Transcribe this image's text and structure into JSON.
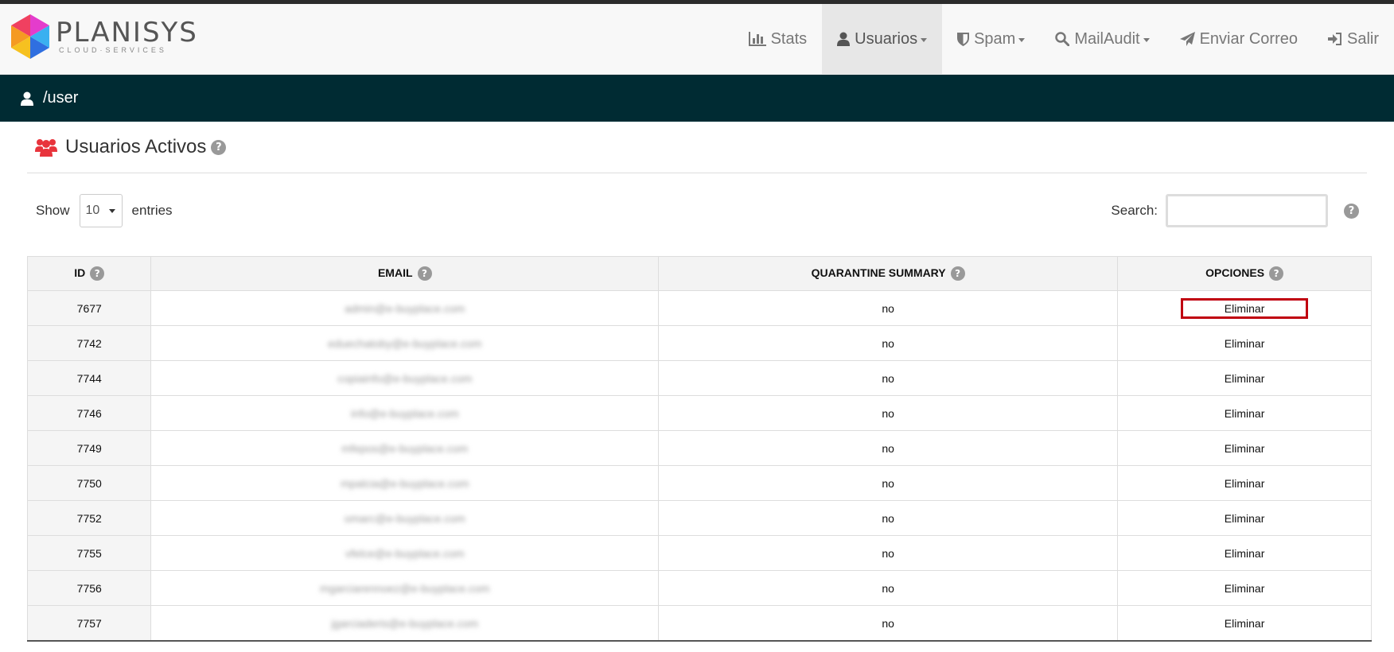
{
  "brand": {
    "name": "PLANISYS",
    "subtitle": "CLOUD·SERVICES"
  },
  "nav": [
    {
      "label": "Stats",
      "icon": "bar-chart-icon",
      "caret": false,
      "active": false
    },
    {
      "label": "Usuarios",
      "icon": "user-icon",
      "caret": true,
      "active": true
    },
    {
      "label": "Spam",
      "icon": "shield-icon",
      "caret": true,
      "active": false
    },
    {
      "label": "MailAudit",
      "icon": "search-icon",
      "caret": true,
      "active": false
    },
    {
      "label": "Enviar Correo",
      "icon": "paper-plane-icon",
      "caret": false,
      "active": false
    },
    {
      "label": "Salir",
      "icon": "sign-in-icon",
      "caret": false,
      "active": false
    }
  ],
  "path": "/user",
  "page": {
    "title": "Usuarios Activos"
  },
  "controls": {
    "show_label": "Show",
    "entries_value": "10",
    "entries_label": "entries",
    "search_label": "Search:",
    "search_value": ""
  },
  "table": {
    "headers": [
      "ID",
      "EMAIL",
      "QUARANTINE SUMMARY",
      "OPCIONES"
    ],
    "rows": [
      {
        "id": "7677",
        "email": "admin@e-buyplace.com",
        "summary": "no",
        "action": "Eliminar",
        "highlight": true
      },
      {
        "id": "7742",
        "email": "eduechatoby@e-buyplace.com",
        "summary": "no",
        "action": "Eliminar",
        "highlight": false
      },
      {
        "id": "7744",
        "email": "copiainfo@e-buyplace.com",
        "summary": "no",
        "action": "Eliminar",
        "highlight": false
      },
      {
        "id": "7746",
        "email": "info@e-buyplace.com",
        "summary": "no",
        "action": "Eliminar",
        "highlight": false
      },
      {
        "id": "7749",
        "email": "mfepos@e-buyplace.com",
        "summary": "no",
        "action": "Eliminar",
        "highlight": false
      },
      {
        "id": "7750",
        "email": "mpalcia@e-buyplace.com",
        "summary": "no",
        "action": "Eliminar",
        "highlight": false
      },
      {
        "id": "7752",
        "email": "omarc@e-buyplace.com",
        "summary": "no",
        "action": "Eliminar",
        "highlight": false
      },
      {
        "id": "7755",
        "email": "vfelce@e-buyplace.com",
        "summary": "no",
        "action": "Eliminar",
        "highlight": false
      },
      {
        "id": "7756",
        "email": "mgarciarennoez@e-buyplace.com",
        "summary": "no",
        "action": "Eliminar",
        "highlight": false
      },
      {
        "id": "7757",
        "email": "jgarciaderis@e-buyplace.com",
        "summary": "no",
        "action": "Eliminar",
        "highlight": false
      }
    ]
  },
  "colors": {
    "path_bar": "#002b33",
    "highlight": "#c00010",
    "group_icon": "#e8343c"
  }
}
